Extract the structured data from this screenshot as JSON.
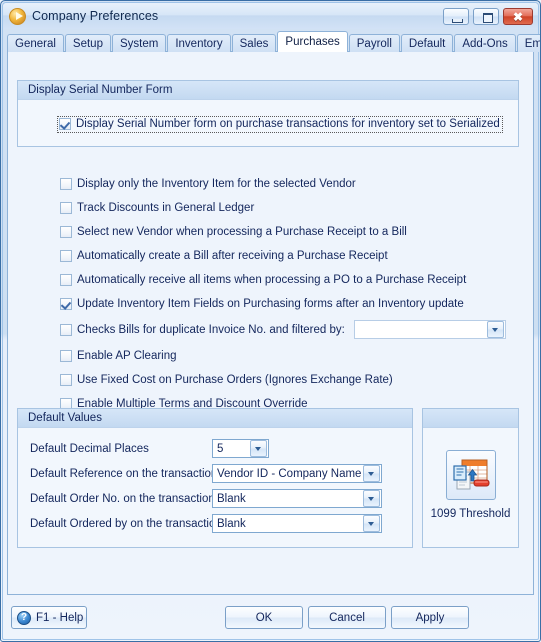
{
  "window": {
    "title": "Company Preferences",
    "app_icon": "play-circle-icon",
    "minimize_label": "Minimize",
    "maximize_label": "Maximize",
    "close_label": "Close",
    "close_glyph": "✖"
  },
  "tabs": [
    {
      "label": "General",
      "active": false
    },
    {
      "label": "Setup",
      "active": false
    },
    {
      "label": "System",
      "active": false
    },
    {
      "label": "Inventory",
      "active": false
    },
    {
      "label": "Sales",
      "active": false
    },
    {
      "label": "Purchases",
      "active": true
    },
    {
      "label": "Payroll",
      "active": false
    },
    {
      "label": "Default",
      "active": false
    },
    {
      "label": "Add-Ons",
      "active": false
    },
    {
      "label": "Email Setup",
      "active": false
    }
  ],
  "serial_group": {
    "header": "Display Serial Number Form",
    "checkbox": {
      "label": "Display Serial Number form on purchase transactions for inventory set to Serialized",
      "checked": true,
      "focused": true
    }
  },
  "options": [
    {
      "label": "Display only the Inventory Item for the selected Vendor",
      "checked": false
    },
    {
      "label": "Track Discounts in General Ledger",
      "checked": false
    },
    {
      "label": "Select new Vendor when processing a Purchase Receipt to a Bill",
      "checked": false
    },
    {
      "label": "Automatically create a Bill after receiving a Purchase Receipt",
      "checked": false
    },
    {
      "label": "Automatically receive all items when processing a PO to a Purchase Receipt",
      "checked": false
    },
    {
      "label": "Update Inventory Item Fields on Purchasing forms after an Inventory update",
      "checked": true
    },
    {
      "label": "Checks Bills for duplicate Invoice No. and filtered by:",
      "checked": false,
      "has_combo": true,
      "combo_value": ""
    },
    {
      "label": "Enable AP Clearing",
      "checked": false
    },
    {
      "label": "Use Fixed Cost on Purchase Orders (Ignores Exchange Rate)",
      "checked": false
    },
    {
      "label": "Enable Multiple Terms and Discount Override",
      "checked": false
    }
  ],
  "default_values": {
    "header": "Default Values",
    "rows": [
      {
        "label": "Default Decimal Places",
        "value": "5"
      },
      {
        "label": "Default Reference on the transactions",
        "value": "Vendor ID - Company Name"
      },
      {
        "label": "Default Order No. on the transactions",
        "value": "Blank"
      },
      {
        "label": "Default Ordered by on the transactions",
        "value": "Blank"
      }
    ]
  },
  "threshold_panel": {
    "header": "",
    "icon": "spreadsheet-upload-icon",
    "caption": "1099 Threshold"
  },
  "footer": {
    "help_label": "F1 - Help",
    "help_icon_glyph": "?",
    "ok_label": "OK",
    "cancel_label": "Cancel",
    "apply_label": "Apply"
  },
  "colors": {
    "accent_blue": "#3a6ea5",
    "panel_bg": "#f2f7fd",
    "client_bg": "#eef4fc",
    "close_red": "#cf4328",
    "text": "#13265c"
  }
}
